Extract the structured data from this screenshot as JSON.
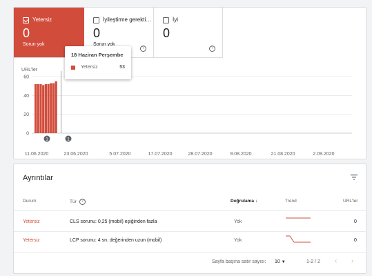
{
  "tiles": [
    {
      "label": "Yetersiz",
      "count": "0",
      "sub": "Sorun yok",
      "checked": true
    },
    {
      "label": "İyileştirme gerekti…",
      "count": "0",
      "sub": "Sorun yok",
      "checked": false
    },
    {
      "label": "İyi",
      "count": "0",
      "sub": "",
      "checked": false
    }
  ],
  "help_glyph": "?",
  "tooltip": {
    "date": "18 Haziran Perşembe",
    "series": "Yetersiz",
    "value": "53"
  },
  "chart_data": {
    "type": "bar",
    "ylabel": "URL'ler",
    "ylim": [
      0,
      60
    ],
    "yticks": [
      "60",
      "40",
      "20",
      "0"
    ],
    "xticks": [
      "11.06.2020",
      "23.06.2020",
      "5.07.2020",
      "17.07.2020",
      "28.07.2020",
      "9.08.2020",
      "21.08.2020",
      "2.09.2020"
    ],
    "annotations": [
      "1",
      "1"
    ],
    "series": [
      {
        "name": "Yetersiz",
        "color": "#d24c3c",
        "x": [
          "11.06",
          "12.06",
          "13.06",
          "14.06",
          "15.06",
          "16.06",
          "17.06",
          "18.06",
          "19.06",
          "20.06",
          "21.06",
          "22.06"
        ],
        "values": [
          52,
          52,
          52,
          51,
          52,
          52,
          53,
          53,
          55,
          0,
          0,
          0
        ]
      }
    ]
  },
  "details": {
    "title": "Ayrıntılar",
    "columns": {
      "status": "Durum",
      "type": "Tür",
      "validation": "Doğrulama",
      "trend": "Trend",
      "urls": "URL'ler"
    },
    "rows": [
      {
        "status": "Yetersiz",
        "type": "CLS sorunu: 0,25 (mobil) eşiğinden fazla",
        "validation": "Yok",
        "trend": "flat",
        "urls": "0"
      },
      {
        "status": "Yetersiz",
        "type": "LCP sorunu: 4 sn. değerinden uzun (mobil)",
        "validation": "Yok",
        "trend": "drop",
        "urls": "0"
      }
    ],
    "footer": {
      "rows_per_page_label": "Sayfa başına satır sayısı:",
      "rows_per_page": "10",
      "range": "1-2 / 2"
    }
  },
  "colors": {
    "accent": "#d24c3c",
    "grid": "#e0e0e0"
  }
}
